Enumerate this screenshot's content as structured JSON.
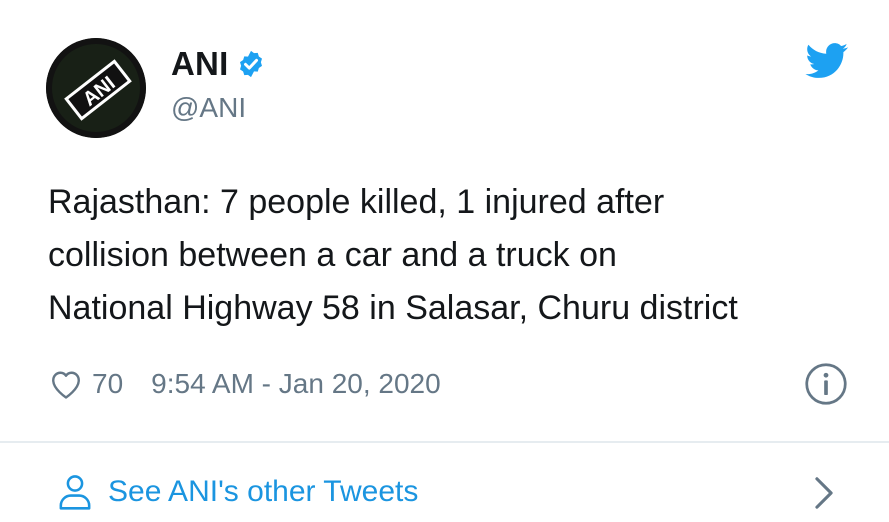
{
  "author": {
    "display_name": "ANI",
    "handle": "@ANI",
    "avatar_text": "ANI",
    "verified": true
  },
  "tweet": {
    "lines": [
      "Rajasthan: 7 people killed, 1 injured after",
      "collision between a car and a truck on",
      "National Highway 58 in Salasar, Churu district"
    ],
    "likes": "70",
    "timestamp": "9:54 AM - Jan 20, 2020"
  },
  "footer": {
    "label": "See ANI's other Tweets"
  },
  "icons": {
    "twitter_bird": "twitter-bird-icon",
    "verified": "verified-badge-icon",
    "like": "heart-icon",
    "info": "info-icon",
    "person": "person-icon",
    "chevron": "chevron-right-icon"
  },
  "colors": {
    "text": "#14171a",
    "secondary_text": "#657786",
    "twitter_blue": "#1da1f2",
    "link_blue": "#1b95e0",
    "divider": "#e6ecf0"
  }
}
